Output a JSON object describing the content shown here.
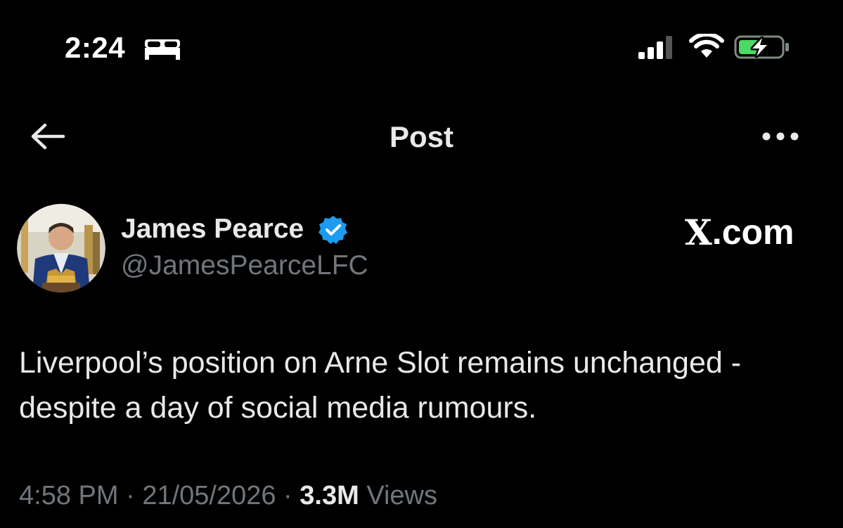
{
  "status_bar": {
    "time": "2:24",
    "focus_icon": "bed-icon",
    "icons": [
      "signal-icon",
      "wifi-icon",
      "battery-charging-icon"
    ],
    "battery_color": "#4cd964"
  },
  "header": {
    "back_icon": "back-arrow-icon",
    "title": "Post",
    "more_icon": "more-icon"
  },
  "author": {
    "name": "James Pearce",
    "handle": "@JamesPearceLFC",
    "verified": true,
    "verified_color": "#1d9bf0"
  },
  "brand": {
    "x": "X",
    "suffix": ".com"
  },
  "post": {
    "text": "Liverpool’s position on Arne Slot remains unchanged - despite a day of social media rumours."
  },
  "meta": {
    "time": "4:58 PM",
    "sep1": " · ",
    "date": "21/05/2026",
    "sep2": " · ",
    "views_count": "3.3M",
    "views_label": " Views"
  }
}
